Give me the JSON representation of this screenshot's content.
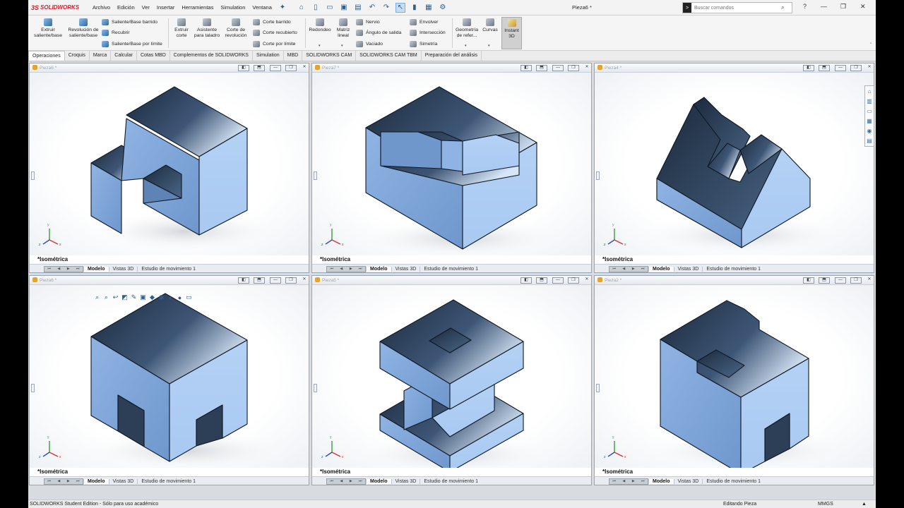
{
  "app": {
    "brand": "SOLIDWORKS",
    "document_title": "Pieza6 *"
  },
  "menu": [
    "Archivo",
    "Edición",
    "Ver",
    "Insertar",
    "Herramientas",
    "Simulation",
    "Ventana"
  ],
  "search": {
    "placeholder": "Buscar comandos"
  },
  "ribbon": {
    "extrude_boss": "Extruir saliente/base",
    "revolve_boss": "Revolución de saliente/base",
    "swept_boss": "Saliente/Base barrido",
    "loft_boss": "Recubrir",
    "boundary_boss": "Saliente/Base por límite",
    "extrude_cut": "Extruir corte",
    "hole_wizard": "Asistente para taladro",
    "revolve_cut": "Corte de revolución",
    "swept_cut": "Corte barrido",
    "loft_cut": "Corte recubierto",
    "boundary_cut": "Corte por límite",
    "fillet": "Redondeo",
    "linear_pattern": "Matriz lineal",
    "rib": "Nervio",
    "draft": "Ángulo de salida",
    "shell": "Vaciado",
    "wrap": "Envolver",
    "intersect": "Intersección",
    "mirror": "Simetría",
    "ref_geometry": "Geometría de refer...",
    "curves": "Curvas",
    "instant3d": "Instant 3D"
  },
  "tabs": [
    "Operaciones",
    "Croquis",
    "Marca",
    "Calcular",
    "Cotas MBD",
    "Complementos de SOLIDWORKS",
    "Simulation",
    "MBD",
    "SOLIDWORKS CAM",
    "SOLIDWORKS CAM TBM",
    "Preparación del análisis"
  ],
  "viewports": [
    {
      "title": "Pieza6 *",
      "view": "*Isométrica",
      "shape": "bracket"
    },
    {
      "title": "Pieza7 *",
      "view": "*Isométrica",
      "shape": "notch"
    },
    {
      "title": "Pieza4 *",
      "view": "*Isométrica",
      "shape": "vblock"
    },
    {
      "title": "Pieza6 *",
      "view": "*Isométrica",
      "shape": "arch"
    },
    {
      "title": "Pieza5 *",
      "view": "*Isométrica",
      "shape": "spool"
    },
    {
      "title": "Pieza2 *",
      "view": "*Isométrica",
      "shape": "step"
    }
  ],
  "footer_tabs": [
    "Modelo",
    "Vistas 3D",
    "Estudio de movimiento 1"
  ],
  "triad": {
    "x": "x",
    "y": "y",
    "z": "z"
  },
  "status": {
    "edition": "SOLIDWORKS Student Edition - Sólo para uso académico",
    "mode": "Editando Pieza",
    "units": "MMGS"
  },
  "colors": {
    "face_light": "#a9c9f2",
    "face_mid": "#7fa8dc",
    "face_dark": "#1c2a3c",
    "edge": "#0e1824",
    "accent": "#d2202f"
  }
}
